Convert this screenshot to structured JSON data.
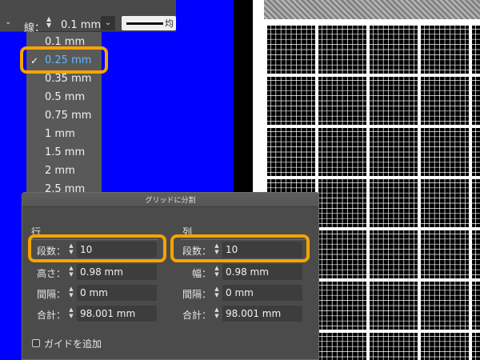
{
  "toolbar": {
    "stroke_label": "線：",
    "stroke_value": "0.1 mm",
    "stroke_style_text": "均"
  },
  "stroke_menu": {
    "items": [
      "0.1 mm",
      "0.25 mm",
      "0.35 mm",
      "0.5 mm",
      "0.75 mm",
      "1 mm",
      "1.5 mm",
      "2 mm",
      "2.5 mm"
    ],
    "selected": "0.25 mm"
  },
  "dialog": {
    "title": "グリッドに分割",
    "rows": {
      "label": "行",
      "count_label": "段数：",
      "count_value": "10",
      "height_label": "高さ：",
      "height_value": "0.98 mm",
      "gutter_label": "間隔：",
      "gutter_value": "0 mm",
      "total_label": "合計：",
      "total_value": "98.001 mm"
    },
    "columns": {
      "label": "列",
      "count_label": "段数：",
      "count_value": "10",
      "width_label": "幅：",
      "width_value": "0.98 mm",
      "gutter_label": "間隔：",
      "gutter_value": "0 mm",
      "total_label": "合計：",
      "total_value": "98.001 mm"
    },
    "add_guides_label": "ガイドを追加"
  },
  "colors": {
    "highlight": "#f5a300",
    "selected_text": "#64b8ff",
    "canvas": "#0000ff"
  }
}
